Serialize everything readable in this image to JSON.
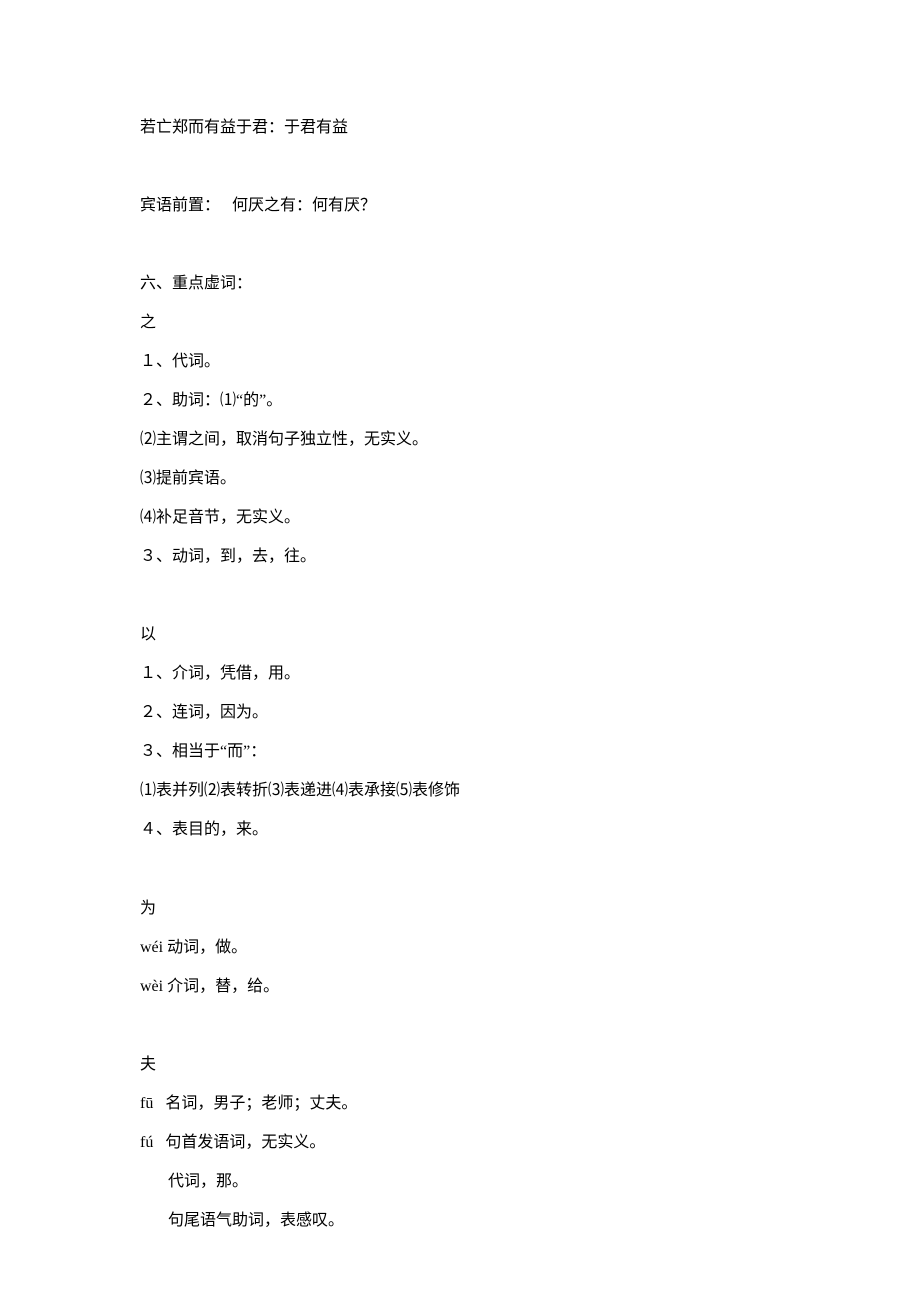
{
  "lines": {
    "l0": "若亡郑而有益于君：于君有益",
    "l1": "宾语前置：   何厌之有：何有厌？",
    "l2": "六、重点虚词：",
    "l3": "之",
    "l4": "１、代词。",
    "l5": "２、助词：⑴“的”。",
    "l6": "⑵主谓之间，取消句子独立性，无实义。",
    "l7": "⑶提前宾语。",
    "l8": "⑷补足音节，无实义。",
    "l9": "３、动词，到，去，往。",
    "l10": "以",
    "l11": "１、介词，凭借，用。",
    "l12": "２、连词，因为。",
    "l13": "３、相当于“而”：",
    "l14": "⑴表并列⑵表转折⑶表递进⑷表承接⑸表修饰",
    "l15": "４、表目的，来。",
    "l16": "为",
    "l17": "wéi 动词，做。",
    "l18": "wèi 介词，替，给。",
    "l19": "夫",
    "l20": "fū   名词，男子；老师；丈夫。",
    "l21": "fú   句首发语词，无实义。",
    "l22": "       代词，那。",
    "l23": "       句尾语气助词，表感叹。"
  }
}
